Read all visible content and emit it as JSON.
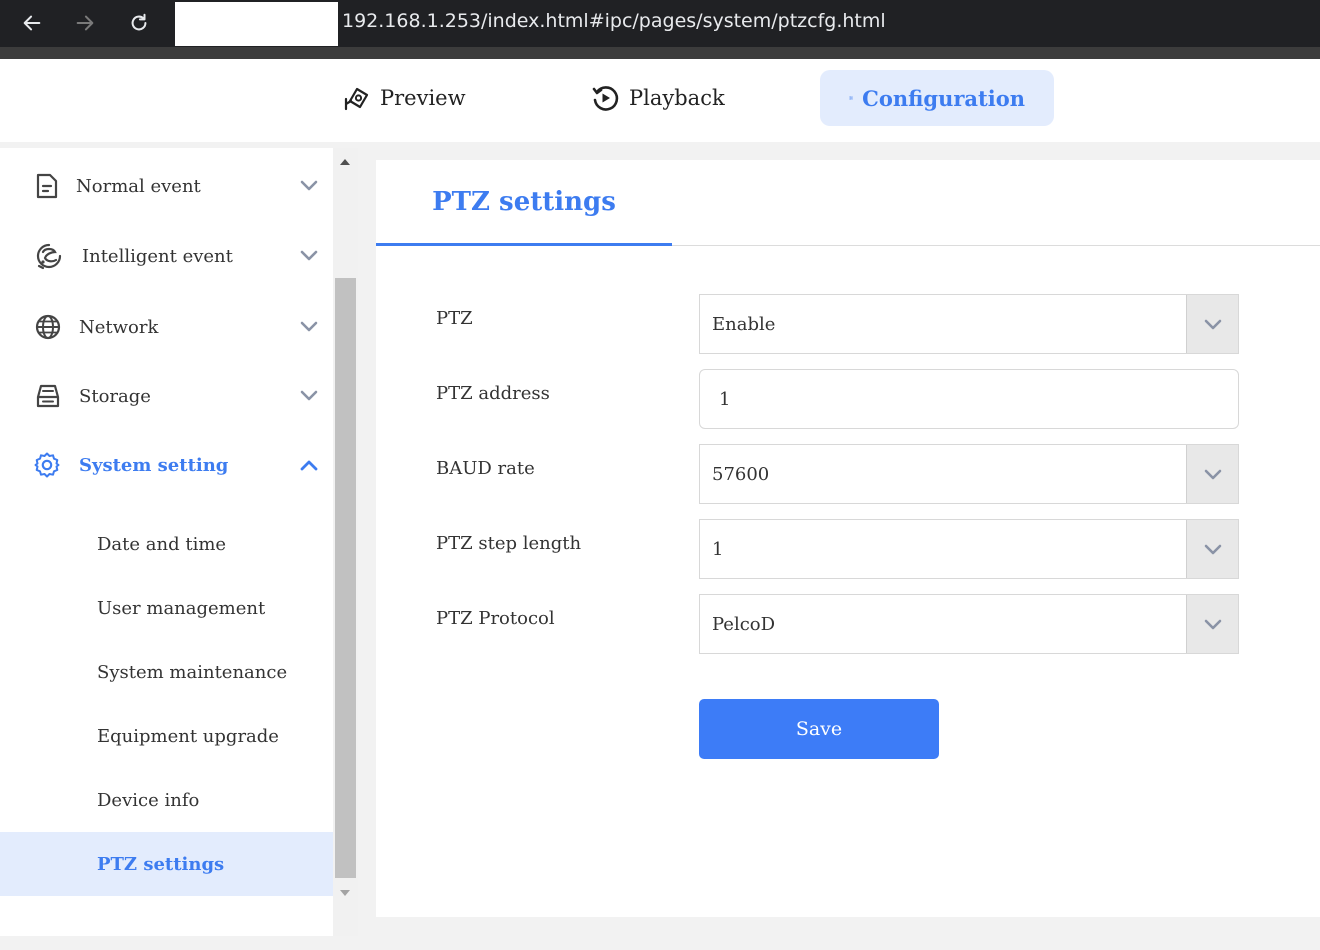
{
  "browser": {
    "url": "192.168.1.253/index.html#ipc/pages/system/ptzcfg.html",
    "icons": {
      "back": "arrow-left-icon",
      "forward": "arrow-right-icon",
      "reload": "reload-icon"
    }
  },
  "top_nav": {
    "tabs": [
      {
        "label": "Preview",
        "icon": "camera-icon"
      },
      {
        "label": "Playback",
        "icon": "playback-icon"
      },
      {
        "label": "Configuration",
        "icon": "sliders-icon",
        "active": true
      }
    ]
  },
  "sidebar": {
    "items": [
      {
        "label": "Normal event",
        "icon": "document-icon",
        "state": "collapsed"
      },
      {
        "label": "Intelligent event",
        "icon": "brain-icon",
        "state": "collapsed"
      },
      {
        "label": "Network",
        "icon": "globe-icon",
        "state": "collapsed"
      },
      {
        "label": "Storage",
        "icon": "storage-icon",
        "state": "collapsed"
      },
      {
        "label": "System setting",
        "icon": "gear-icon",
        "state": "expanded"
      }
    ],
    "sub_items": [
      {
        "label": "Date and time"
      },
      {
        "label": "User management"
      },
      {
        "label": "System maintenance"
      },
      {
        "label": "Equipment upgrade"
      },
      {
        "label": "Device info"
      },
      {
        "label": "PTZ settings",
        "active": true
      }
    ]
  },
  "main": {
    "tab_title": "PTZ settings",
    "fields": {
      "ptz": {
        "label": "PTZ",
        "value": "Enable",
        "type": "select"
      },
      "address": {
        "label": "PTZ address",
        "value": "1",
        "type": "input"
      },
      "baud": {
        "label": "BAUD rate",
        "value": "57600",
        "type": "select"
      },
      "step": {
        "label": "PTZ step length",
        "value": "1",
        "type": "select"
      },
      "protocol": {
        "label": "PTZ Protocol",
        "value": "PelcoD",
        "type": "select"
      }
    },
    "save_label": "Save"
  },
  "colors": {
    "accent": "#3d7cf0",
    "accent_bg": "#e3ecfd",
    "browser_bar": "#202124",
    "button": "#3d7cf7"
  }
}
